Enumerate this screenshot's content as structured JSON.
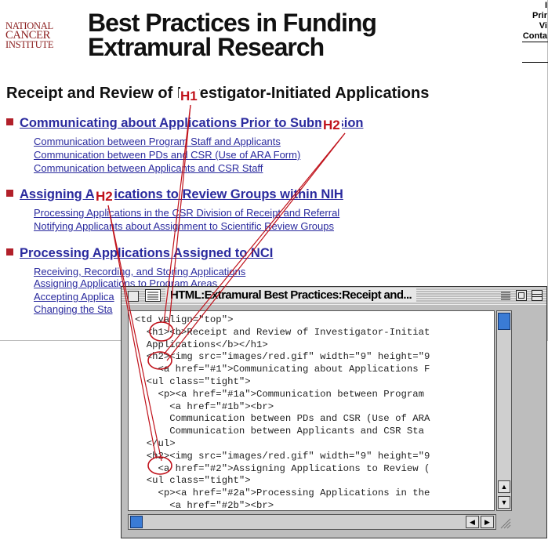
{
  "site": {
    "logo_lines": [
      "NATIONAL",
      "CANCER",
      "INSTITUTE"
    ],
    "title_lines": [
      "Best Practices in Funding",
      "Extramural Research"
    ],
    "top_links": [
      "I",
      "Prir",
      "Vi",
      "Conta"
    ]
  },
  "page_heading": "Receipt and Review of Investigator-Initiated Applications",
  "sections": [
    {
      "title": "Communicating about Applications Prior to Submission",
      "links": [
        "Communication between Program Staff and Applicants",
        "Communication between PDs and CSR (Use of ARA Form)",
        "Communication between Applicants and CSR Staff"
      ]
    },
    {
      "title": "Assigning Applications to Review Groups within NIH",
      "links": [
        "Processing Applications in the CSR Division of Receipt and Referral",
        "Notifying Applicants about Assignment to Scientific Review Groups"
      ]
    },
    {
      "title": "Processing Applications Assigned to NCI",
      "links": [
        "Receiving, Recording, and Storing Applications",
        "Assigning Applications to Program Areas",
        "Accepting Applica",
        "Changing the Sta"
      ]
    }
  ],
  "annotations": {
    "h1": "H1",
    "h2_top": "H2",
    "h2_left": "H2"
  },
  "source_window": {
    "title": "HTML:Extramural Best Practices:Receipt and...",
    "code_lines": [
      "<td valign=\"top\">",
      "  <h1><b>Receipt and Review of Investigator-Initiat",
      "  Applications</b></h1>",
      "  <h2><img src=\"images/red.gif\" width=\"9\" height=\"9",
      "    <a href=\"#1\">Communicating about Applications F",
      "  <ul class=\"tight\">",
      "    <p><a href=\"#1a\">Communication between Program",
      "      <a href=\"#1b\"><br>",
      "      Communication between PDs and CSR (Use of ARA",
      "      Communication between Applicants and CSR Sta",
      "  </ul>",
      "  <h2><img src=\"images/red.gif\" width=\"9\" height=\"9",
      "    <a href=\"#2\">Assigning Applications to Review (",
      "  <ul class=\"tight\">",
      "    <p><a href=\"#2a\">Processing Applications in the",
      "      <a href=\"#2b\"><br>"
    ]
  },
  "colors": {
    "annotation": "#c0121b",
    "link": "#2a2a9e",
    "bullet": "#b2202a",
    "scroll_thumb": "#3a7bd5"
  }
}
